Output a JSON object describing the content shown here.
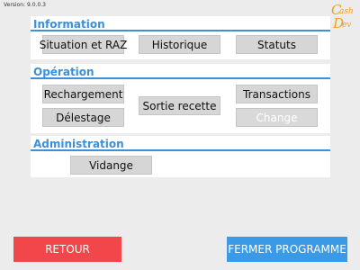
{
  "version": "Version: 9.0.0.3",
  "logo": {
    "line1": "ash",
    "line2": "ev",
    "icon": "cash-dev-logo"
  },
  "sections": {
    "information": {
      "title": "Information",
      "buttons": {
        "situation": "Situation et RAZ",
        "historique": "Historique",
        "statuts": "Statuts"
      }
    },
    "operation": {
      "title": "Opération",
      "buttons": {
        "rechargement": "Rechargement",
        "sortie": "Sortie recette",
        "transactions": "Transactions",
        "delestage": "Délestage",
        "change": "Change"
      }
    },
    "administration": {
      "title": "Administration",
      "buttons": {
        "vidange": "Vidange"
      }
    }
  },
  "footer": {
    "retour": "RETOUR",
    "fermer": "FERMER PROGRAMME"
  },
  "colors": {
    "accent": "#3d8fd6",
    "retour": "#f2474a",
    "fermer": "#3a9ae8",
    "logo": "#f0a020"
  }
}
